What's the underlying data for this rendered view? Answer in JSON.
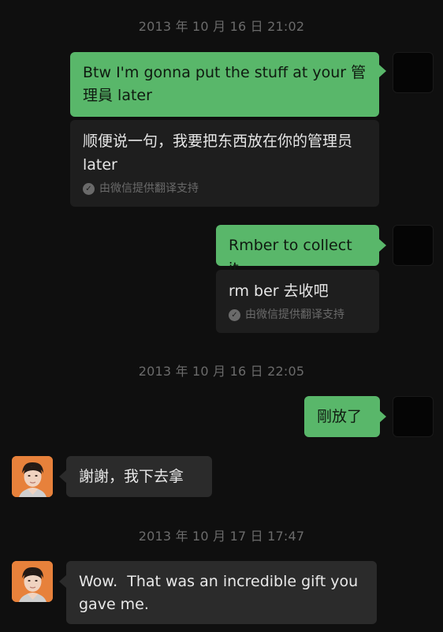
{
  "timestamps": [
    "2013 年 10 月 16 日 21:02",
    "2013 年 10 月 16 日 22:05",
    "2013 年 10 月 17 日 17:47"
  ],
  "messages": {
    "m1": {
      "text": "Btw I'm gonna put the stuff at your 管理員 later",
      "translation": "顺便说一句，我要把东西放在你的管理员 later"
    },
    "m2": {
      "text": "Rmber to collect it",
      "translation": "rm ber 去收吧"
    },
    "m3": {
      "text": "剛放了"
    },
    "m4": {
      "text": "謝謝，我下去拿"
    },
    "m5": {
      "text": "Wow.  That was an incredible gift you gave me."
    }
  },
  "translation_note": "由微信提供翻译支持",
  "icons": {
    "check": "check-circle-icon"
  },
  "colors": {
    "outgoing": "#59b76a",
    "incoming": "#2b2b2b",
    "background": "#0f0f0f",
    "avatar_bg": "#e7813b"
  }
}
